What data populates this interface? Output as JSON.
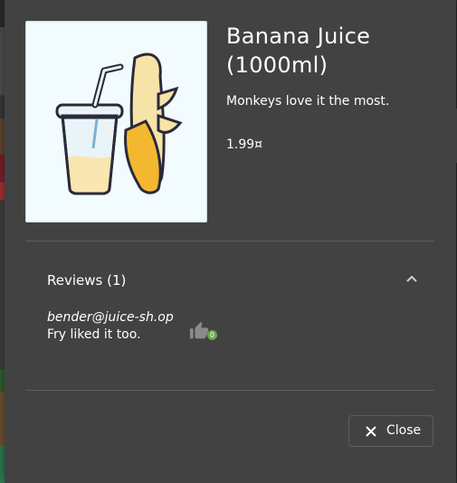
{
  "product": {
    "name": "Banana Juice (1000ml)",
    "description": "Monkeys love it the most.",
    "price": "1.99¤",
    "image_icon": "banana-juice-illustration"
  },
  "reviews": {
    "header_label": "Reviews (1)",
    "expanded": true,
    "items": [
      {
        "author": "bender@juice-sh.op",
        "message": "Fry liked it too.",
        "likes": "0"
      }
    ]
  },
  "actions": {
    "close_label": "Close"
  },
  "colors": {
    "dialog_bg": "#424242",
    "text": "#ffffff",
    "like_badge": "#6aa84f",
    "divider": "#5e5e5e"
  }
}
